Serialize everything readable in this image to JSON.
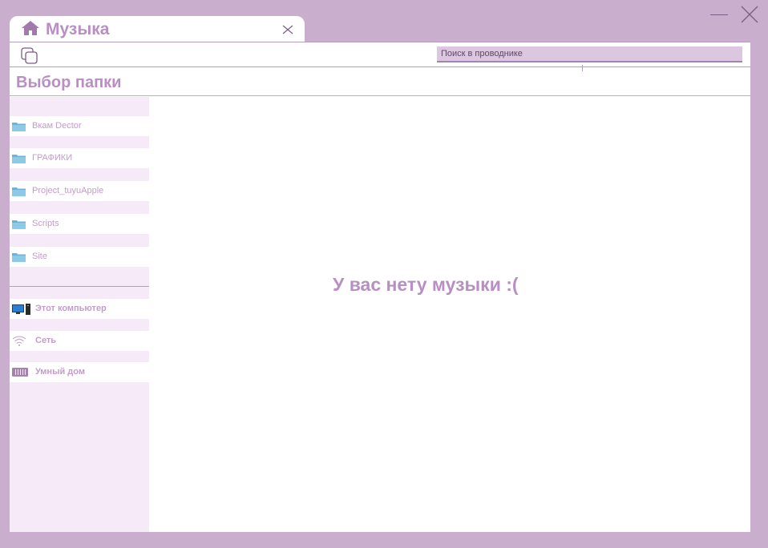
{
  "tab": {
    "title": "Музыка",
    "home_icon": "home-icon",
    "close_icon": "close-icon"
  },
  "window_controls": {
    "minimize_icon": "minimize-icon",
    "close_icon": "close-icon"
  },
  "toolbar": {
    "copy_icon": "copy-icon",
    "search_value": "Поиск в проводнике"
  },
  "page": {
    "title": "Выбор папки",
    "empty_message": "У вас нету музыки :("
  },
  "sidebar": {
    "folders": [
      {
        "label": "Вкам Dector",
        "icon": "folder-icon"
      },
      {
        "label": "ГРАФИКИ",
        "icon": "folder-icon"
      },
      {
        "label": "Project_tuyuApple",
        "icon": "folder-icon"
      },
      {
        "label": "Scripts",
        "icon": "folder-icon"
      },
      {
        "label": "Site",
        "icon": "folder-icon"
      }
    ],
    "devices": [
      {
        "label": "Этот компьютер",
        "icon": "computer-icon"
      },
      {
        "label": "Сеть",
        "icon": "wifi-icon"
      },
      {
        "label": "Умный дом",
        "icon": "smart-home-icon"
      }
    ]
  },
  "colors": {
    "background": "#c9aecd",
    "accent_text": "#b88fc2",
    "sidebar_bg": "#f6eaf8",
    "search_bg": "#dcc7e0"
  }
}
